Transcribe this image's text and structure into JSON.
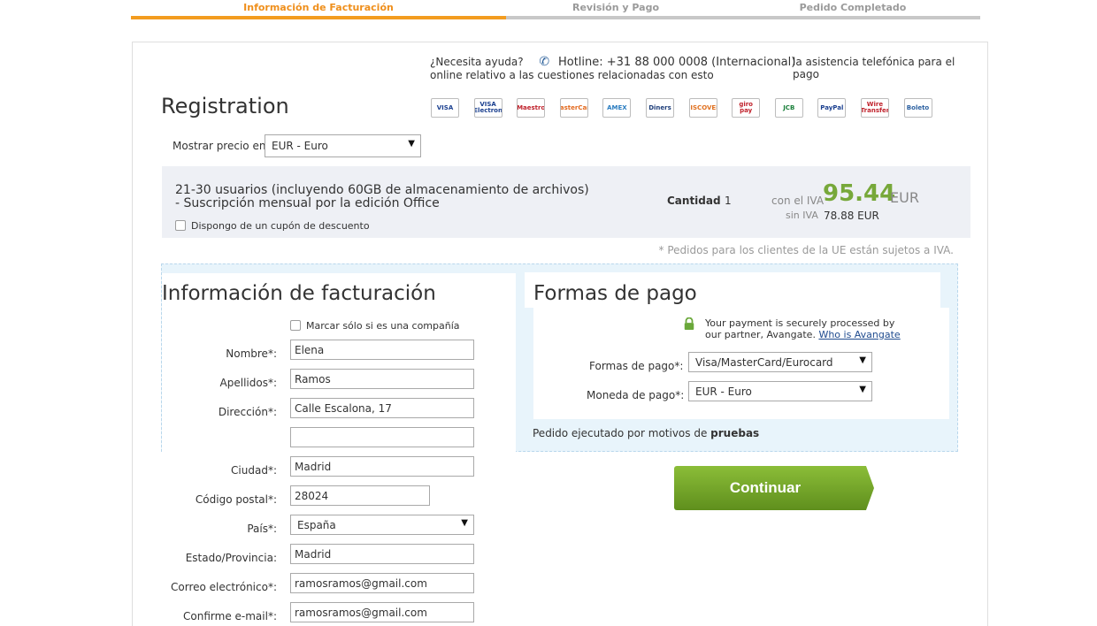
{
  "steps": [
    {
      "label": "Información de Facturación",
      "active": true
    },
    {
      "label": "Revisión y Pago",
      "active": false
    },
    {
      "label": "Pedido Completado",
      "active": false
    }
  ],
  "help": {
    "question": "¿Necesita ayuda?",
    "hotline": "Hotline: +31 88 000 0008 (Internacional)",
    "assist_line1": "la asistencia telefónica para el pago",
    "assist_line2": "online relativo a las cuestiones relacionadas con esto"
  },
  "registration_title": "Registration",
  "card_logos": [
    {
      "name": "visa-logo",
      "label": "VISA",
      "color": "#1a3f8f"
    },
    {
      "name": "visa-electron-logo",
      "label": "VISA Electron",
      "color": "#1a3f8f"
    },
    {
      "name": "maestro-logo",
      "label": "Maestro",
      "color": "#c0222c"
    },
    {
      "name": "mastercard-logo",
      "label": "MasterCard",
      "color": "#e36a1f"
    },
    {
      "name": "amex-logo",
      "label": "AMEX",
      "color": "#2a7cc0"
    },
    {
      "name": "diners-logo",
      "label": "Diners",
      "color": "#1f3f7a"
    },
    {
      "name": "discover-logo",
      "label": "DISCOVER",
      "color": "#e0701f"
    },
    {
      "name": "giropay-logo",
      "label": "giro pay",
      "color": "#c0222c"
    },
    {
      "name": "jcb-logo",
      "label": "JCB",
      "color": "#1a7f3a"
    },
    {
      "name": "paypal-logo",
      "label": "PayPal",
      "color": "#1a3f8f"
    },
    {
      "name": "wire-transfer-logo",
      "label": "Wire Transfer",
      "color": "#c0222c"
    },
    {
      "name": "boleto-logo",
      "label": "Boleto",
      "color": "#2a5fa0"
    }
  ],
  "price_currency": {
    "label": "Mostrar precio en:",
    "value": "EUR - Euro"
  },
  "product": {
    "line1": "21-30 usuarios (incluyendo 60GB de almacenamiento de archivos)",
    "line2": "- Suscripción mensual por la edición Office",
    "quantity_label": "Cantidad",
    "quantity": "1",
    "with_vat_label": "con el IVA",
    "price": "95.44",
    "currency": "EUR",
    "without_vat_label": "sin IVA",
    "without_vat_value": "78.88 EUR",
    "coupon_label": "Dispongo de un cupón de descuento"
  },
  "vat_note": "* Pedidos para los clientes de la UE están sujetos a IVA.",
  "billing": {
    "title": "Información de facturación",
    "company_label": "Marcar sólo si es una compañía",
    "fields": {
      "nombre": {
        "label": "Nombre*:",
        "value": "Elena"
      },
      "apellidos": {
        "label": "Apellidos*:",
        "value": "Ramos"
      },
      "direccion": {
        "label": "Dirección*:",
        "value": "Calle Escalona, 17"
      },
      "direccion2": {
        "value": ""
      },
      "ciudad": {
        "label": "Ciudad*:",
        "value": "Madrid"
      },
      "postal": {
        "label": "Código postal*:",
        "value": "28024"
      },
      "pais": {
        "label": "País*:",
        "value": "España"
      },
      "estado": {
        "label": "Estado/Provincia:",
        "value": "Madrid"
      },
      "correo": {
        "label": "Correo electrónico*:",
        "value": "ramosramos@gmail.com"
      },
      "confirm": {
        "label": "Confirme e-mail*:",
        "value": "ramosramos@gmail.com"
      }
    }
  },
  "payment": {
    "title": "Formas de pago",
    "secure_text": "Your payment is securely processed by our partner, Avangate.",
    "secure_link": "Who is Avangate",
    "method_label": "Formas de pago*:",
    "method_value": "Visa/MasterCard/Eurocard",
    "currency_label": "Moneda de pago*:",
    "currency_value": "EUR - Euro",
    "order_note": "Pedido ejecutado por motivos de",
    "order_note_bold": "pruebas"
  },
  "continue_label": "Continuar"
}
